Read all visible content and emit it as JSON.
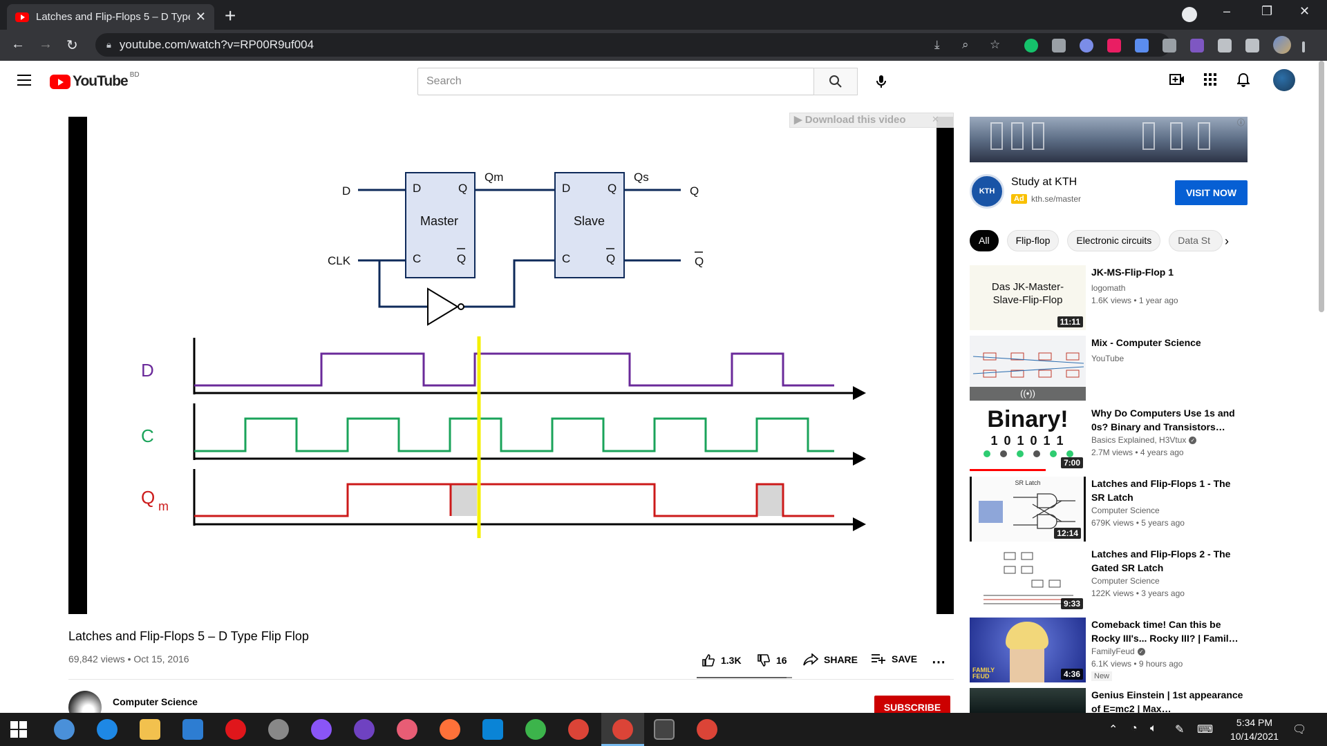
{
  "browser": {
    "tab_title": "Latches and Flip-Flops 5 – D Type Flip Flop",
    "url": "youtube.com/watch?v=RP00R9uf004"
  },
  "youtube": {
    "logo_text": "YouTube",
    "country_code": "BD",
    "search_placeholder": "Search"
  },
  "video": {
    "title": "Latches and Flip-Flops 5 – D Type Flip Flop",
    "meta": "69,842 views • Oct 15, 2016",
    "likes": "1.3K",
    "dislikes": "16",
    "share_label": "SHARE",
    "save_label": "SAVE",
    "channel": "Computer Science",
    "subscribe_label": "SUBSCRIBE",
    "download_overlay": "▶ Download this video",
    "like_ratio": 0.94
  },
  "diagram": {
    "master_label": "Master",
    "slave_label": "Slave",
    "pin_d": "D",
    "pin_q": "Q",
    "pin_c": "C",
    "pin_qbar": "Q",
    "input_d": "D",
    "input_clk": "CLK",
    "mid_label": "Qm",
    "out_label": "Qs",
    "out_q": "Q",
    "out_qbar": "Q",
    "trace_d": "D",
    "trace_c": "C",
    "trace_q": "Q",
    "trace_q_sub": "m",
    "colors": {
      "d": "#6a2a9a",
      "c": "#1aa35a",
      "q": "#cc1a1a",
      "cursor": "#f4f000",
      "block_fill": "#dce3f3",
      "block_stroke": "#0e2a5a"
    }
  },
  "ad": {
    "title": "Study at KTH",
    "tag": "Ad",
    "url": "kth.se/master",
    "button": "VISIT NOW",
    "logo_text": "KTH",
    "info_icon": "info-icon"
  },
  "chips": [
    "All",
    "Flip-flop",
    "Electronic circuits",
    "Data St"
  ],
  "recommendations": [
    {
      "title": "JK-MS-Flip-Flop 1",
      "channel": "logomath",
      "meta": "1.6K views • 1 year ago",
      "duration": "11:11",
      "thumb_text_1": "Das JK-Master-",
      "thumb_text_2": "Slave-Flip-Flop"
    },
    {
      "title": "Mix - Computer Science",
      "channel": "YouTube",
      "meta": "",
      "duration": "",
      "live_icon": "broadcast-icon"
    },
    {
      "title": "Why Do Computers Use 1s and 0s? Binary and Transistors…",
      "channel": "Basics Explained, H3Vtux",
      "meta": "2.7M views • 4 years ago",
      "duration": "7:00",
      "thumb_text_1": "Binary!",
      "thumb_text_2": "1 0 1 0 1 1"
    },
    {
      "title": "Latches and Flip-Flops 1 - The SR Latch",
      "channel": "Computer Science",
      "meta": "679K views • 5 years ago",
      "duration": "12:14",
      "thumb_text_1": "SR Latch"
    },
    {
      "title": "Latches and Flip-Flops 2 - The Gated SR Latch",
      "channel": "Computer Science",
      "meta": "122K views • 3 years ago",
      "duration": "9:33"
    },
    {
      "title": "Comeback time! Can this be Rocky III's... Rocky III? | Famil…",
      "channel": "FamilyFeud",
      "meta": "6.1K views • 9 hours ago",
      "duration": "4:36",
      "badge": "New",
      "thumb_text_1": "FAMILY FEUD"
    },
    {
      "title": "Genius Einstein | 1st appearance of E=mc2 | Max…",
      "channel": "",
      "meta": "",
      "duration": ""
    }
  ],
  "taskbar": {
    "time": "5:34 PM",
    "date": "10/14/2021"
  }
}
